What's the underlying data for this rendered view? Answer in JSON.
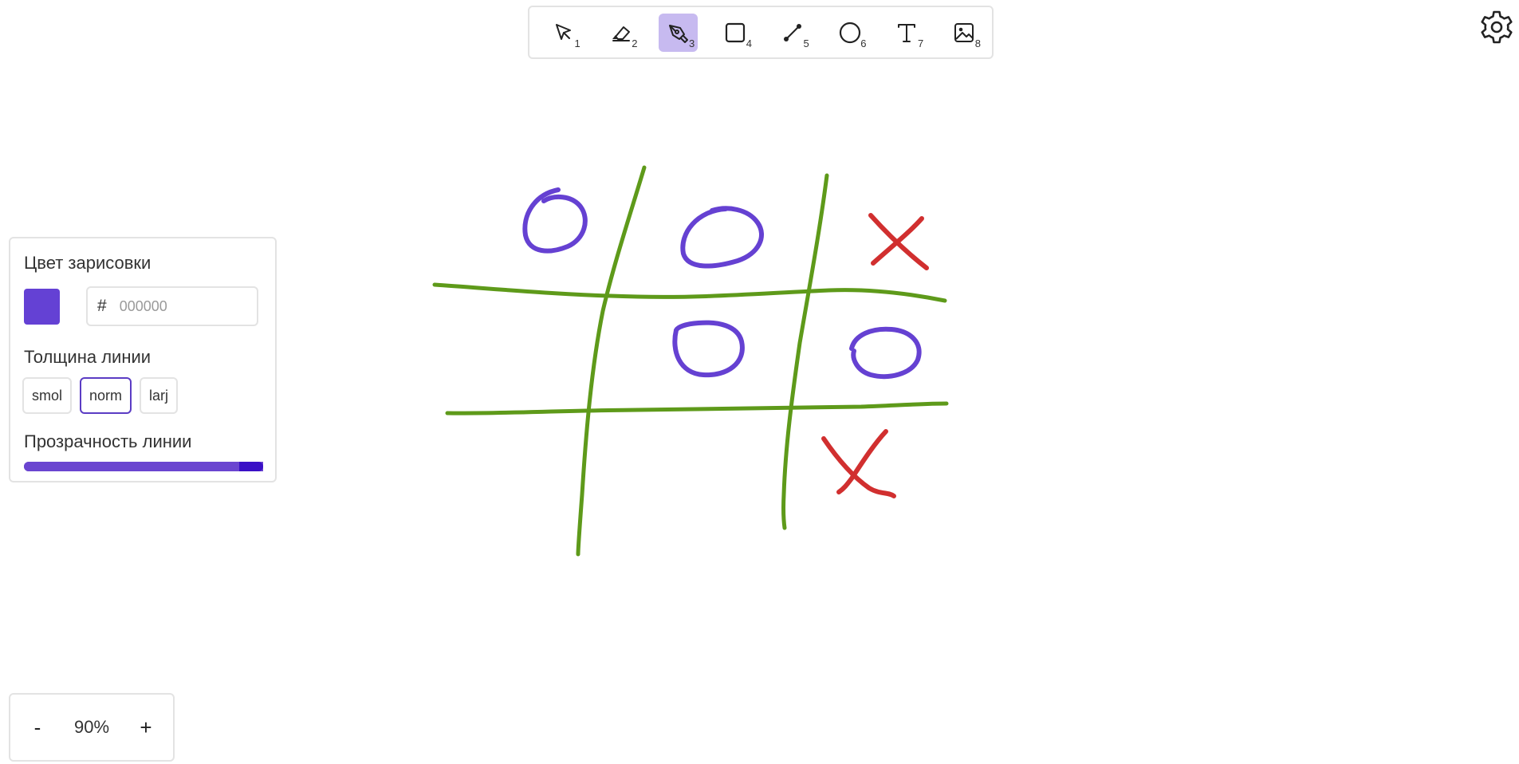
{
  "toolbar": {
    "tools": [
      {
        "name": "select",
        "shortcut": "1",
        "icon": "cursor-arrow-icon"
      },
      {
        "name": "eraser",
        "shortcut": "2",
        "icon": "eraser-icon"
      },
      {
        "name": "pen",
        "shortcut": "3",
        "icon": "pen-nib-icon",
        "active": true
      },
      {
        "name": "rectangle",
        "shortcut": "4",
        "icon": "square-icon"
      },
      {
        "name": "line",
        "shortcut": "5",
        "icon": "line-icon"
      },
      {
        "name": "ellipse",
        "shortcut": "6",
        "icon": "circle-icon"
      },
      {
        "name": "text",
        "shortcut": "7",
        "icon": "text-t-icon"
      },
      {
        "name": "image",
        "shortcut": "8",
        "icon": "image-icon"
      }
    ]
  },
  "settings": {
    "icon": "gear-icon"
  },
  "panel": {
    "stroke_color_label": "Цвет зарисовки",
    "stroke_color": "#6441d4",
    "hex_prefix": "#",
    "hex_placeholder": "000000",
    "hex_value": "",
    "thickness_label": "Толщина линии",
    "thickness_options": [
      "smol",
      "norm",
      "larj"
    ],
    "thickness_selected": "norm",
    "opacity_label": "Прозрачность линии",
    "opacity_value": 1.0
  },
  "zoom": {
    "minus_label": "-",
    "level": "90%",
    "plus_label": "+"
  },
  "colors": {
    "accent": "#6441d4",
    "grid_stroke": "#5e9a1a",
    "o_stroke": "#6541d2",
    "x_stroke": "#d12f2f",
    "active_tool_bg": "#c7baf0"
  },
  "drawing": {
    "description_marks": [
      "grid",
      "O",
      "O",
      "X",
      "O",
      "O",
      "X"
    ]
  }
}
